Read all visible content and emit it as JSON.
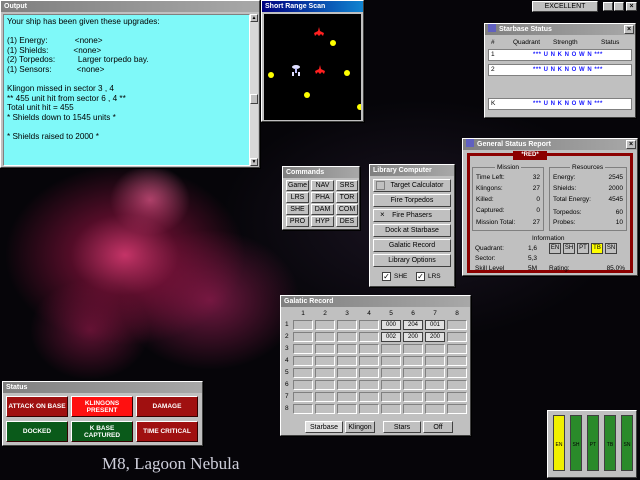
{
  "rank": {
    "label": "EXCELLENT"
  },
  "output": {
    "title": "Output",
    "lines": "Your ship has been given these upgrades:\n\n(1) Energy:            <none>\n(1) Shields:           <none>\n(2) Torpedos:          Larger torpedo bay.\n(1) Sensors:           <none>\n\nKlingon missed in sector 3 , 4\n** 455 unit hit from sector 6 , 4 **\nTotal unit hit = 455\n* Shields down to 1545 units *\n\n* Shields raised to 2000 *"
  },
  "srs": {
    "title": "Short Range Scan"
  },
  "starbase": {
    "title": "Starbase Status",
    "headers": [
      "#",
      "Quadrant",
      "Strength",
      "Status"
    ],
    "rows": [
      {
        "id": "1",
        "text": "*** U N K N O W N ***"
      },
      {
        "id": "2",
        "text": "*** U N K N O W N ***"
      },
      {
        "id": "K",
        "text": "*** U N K N O W N ***"
      }
    ]
  },
  "gsr": {
    "title": "General Status Report",
    "alert": "*RED*",
    "mission_title": "Mission",
    "resources_title": "Resources",
    "information_title": "Information",
    "mission": [
      {
        "label": "Time Left:",
        "value": "32"
      },
      {
        "label": "Klingons:",
        "value": "27"
      },
      {
        "label": "Killed:",
        "value": "0"
      },
      {
        "label": "Captured:",
        "value": "0"
      },
      {
        "label": "Mission Total:",
        "value": "27"
      }
    ],
    "resources": [
      {
        "label": "Energy:",
        "value": "2545"
      },
      {
        "label": "Shields:",
        "value": "2000"
      },
      {
        "label": "Total Energy:",
        "value": "4545"
      },
      {
        "label": "Torpedos:",
        "value": "60"
      },
      {
        "label": "Probes:",
        "value": "10"
      }
    ],
    "info": [
      {
        "label": "Quadrant:",
        "value": "1,6"
      },
      {
        "label": "Sector:",
        "value": "5,3"
      },
      {
        "label": "Skill Level",
        "value": "5M"
      }
    ],
    "rating_label": "Rating:",
    "rating_value": "85.0%",
    "tags": [
      "EN",
      "SH",
      "PT",
      "TB",
      "SN"
    ]
  },
  "commands": {
    "title": "Commands",
    "buttons": [
      "Game",
      "NAV",
      "SRS",
      "LRS",
      "PHA",
      "TOR",
      "SHE",
      "DAM",
      "COM",
      "PRO",
      "HYP",
      "DES"
    ]
  },
  "library": {
    "title": "Library Computer",
    "buttons": [
      "Target Calculator",
      "Fire Torpedos",
      "Fire Phasers",
      "Dock at Starbase",
      "Galatic Record",
      "Library Options"
    ],
    "check1": "SHE",
    "check2": "LRS"
  },
  "galactic": {
    "title": "Galatic Record",
    "cols": [
      "1",
      "2",
      "3",
      "4",
      "5",
      "6",
      "7",
      "8"
    ],
    "rows": [
      "1",
      "2",
      "3",
      "4",
      "5",
      "6",
      "7",
      "8"
    ],
    "cells_row1": [
      "000",
      "204",
      "001"
    ],
    "cells_row2": [
      "002",
      "200",
      "200"
    ],
    "tabs": [
      "Starbase",
      "Klingon",
      "Stars",
      "Off"
    ]
  },
  "status": {
    "title": "Status",
    "buttons": [
      {
        "label": "ATTACK ON BASE",
        "color": "#a01010"
      },
      {
        "label": "KLINGONS PRESENT",
        "color": "#ff1010"
      },
      {
        "label": "DAMAGE",
        "color": "#a01010"
      },
      {
        "label": "DOCKED",
        "color": "#0a5a1a"
      },
      {
        "label": "K BASE CAPTURED",
        "color": "#0a5a1a"
      },
      {
        "label": "TIME CRITICAL",
        "color": "#a01010"
      }
    ]
  },
  "meters": {
    "labels": [
      "EN",
      "SH",
      "PT",
      "TB",
      "SN"
    ],
    "levels": [
      0.95,
      0.95,
      0.95,
      0.95,
      0.95
    ]
  },
  "caption": "M8, Lagoon Nebula"
}
